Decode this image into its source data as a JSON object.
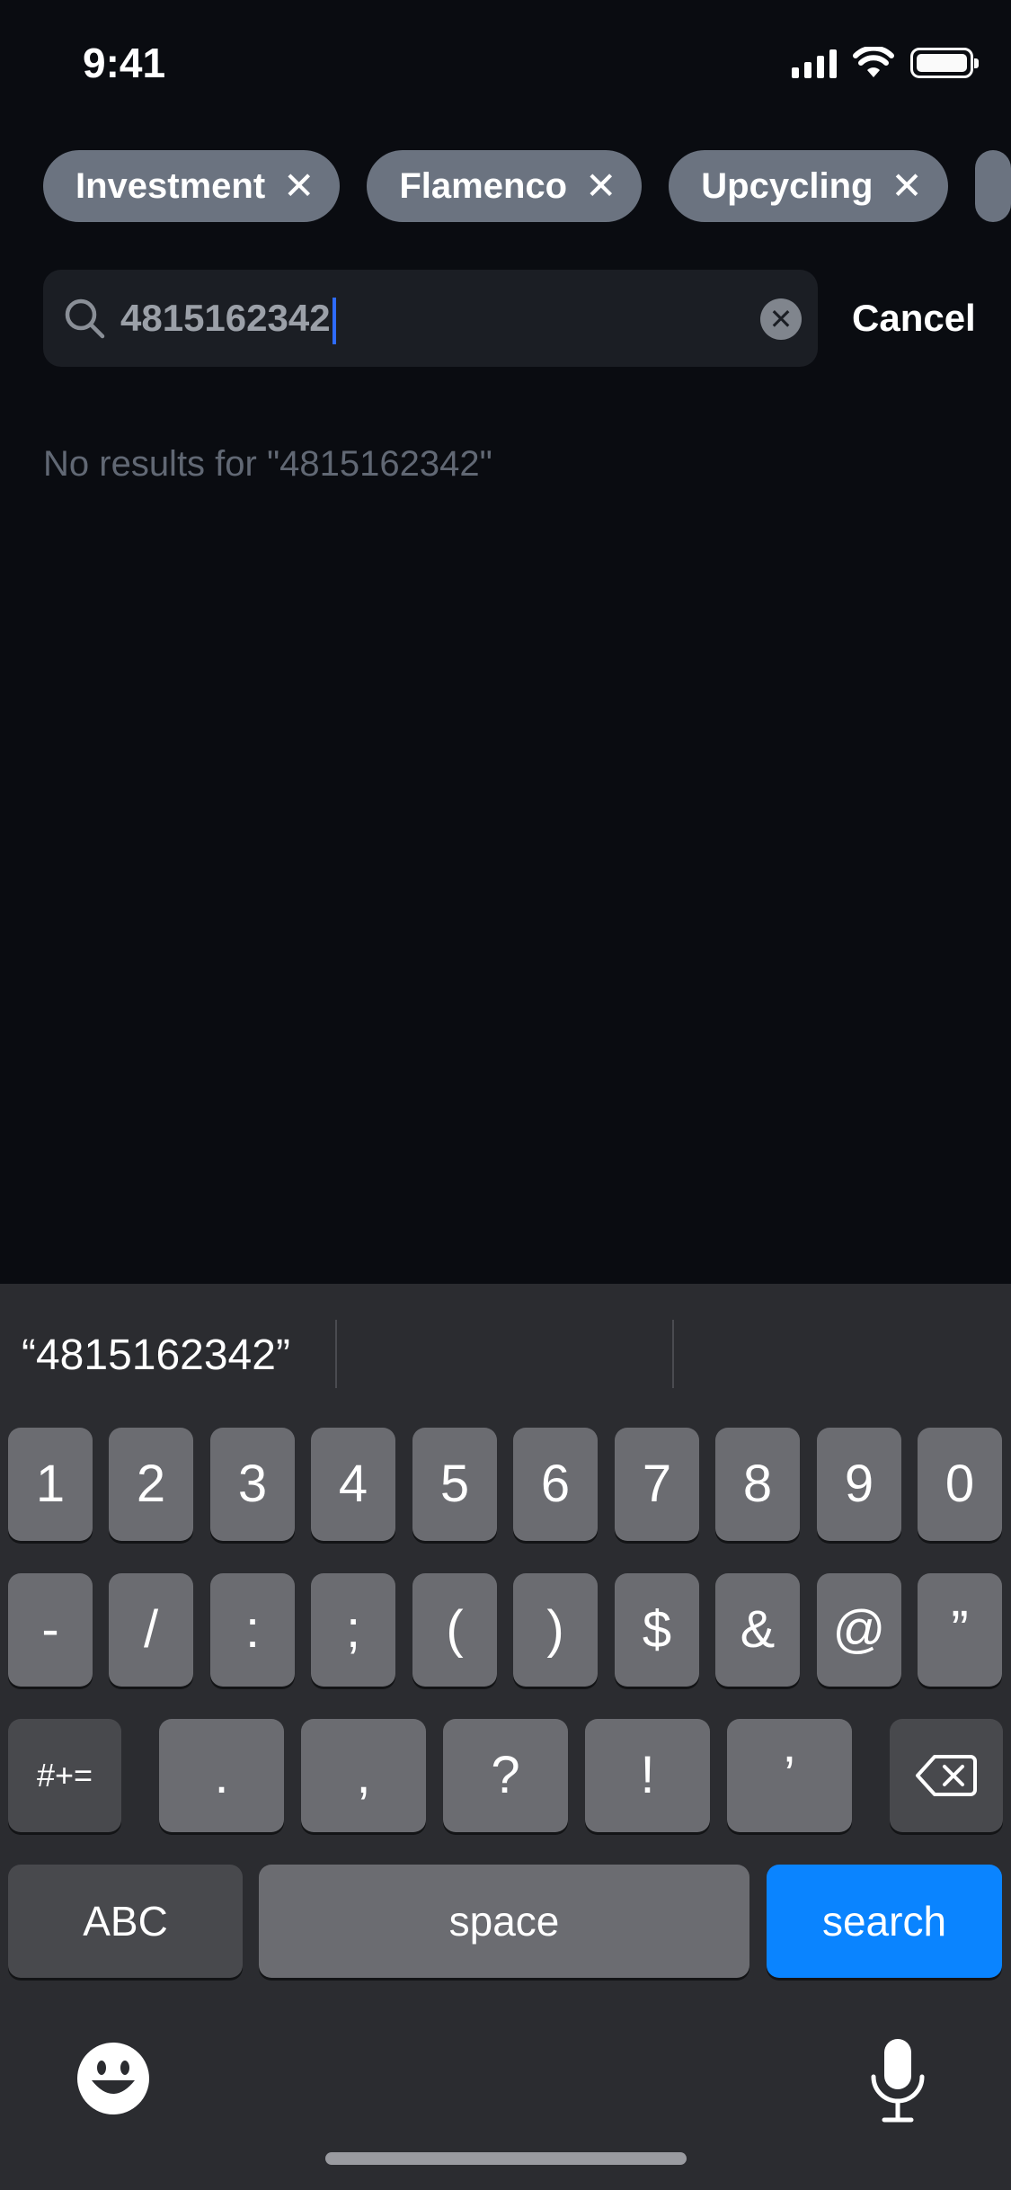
{
  "status_bar": {
    "time": "9:41"
  },
  "chips": [
    {
      "label": "Investment",
      "remove": "✕"
    },
    {
      "label": "Flamenco",
      "remove": "✕"
    },
    {
      "label": "Upcycling",
      "remove": "✕"
    }
  ],
  "search": {
    "value": "4815162342",
    "cancel_label": "Cancel",
    "clear_symbol": "✕"
  },
  "results": {
    "empty_message": "No results for \"4815162342\""
  },
  "keyboard": {
    "suggestion": "“4815162342”",
    "row1": [
      "1",
      "2",
      "3",
      "4",
      "5",
      "6",
      "7",
      "8",
      "9",
      "0"
    ],
    "row2": [
      "-",
      "/",
      ":",
      ";",
      "(",
      ")",
      "$",
      "&",
      "@",
      "”"
    ],
    "row3": {
      "shift_label": "#+=",
      "keys": [
        ".",
        ",",
        "?",
        "!",
        "’"
      ]
    },
    "row4": {
      "abc_label": "ABC",
      "space_label": "space",
      "search_label": "search"
    }
  },
  "colors": {
    "background": "#0a0c11",
    "chip": "#6b7380",
    "search_field": "#1b1e24",
    "accent_blue": "#0a84ff",
    "cursor": "#2e6bff"
  }
}
